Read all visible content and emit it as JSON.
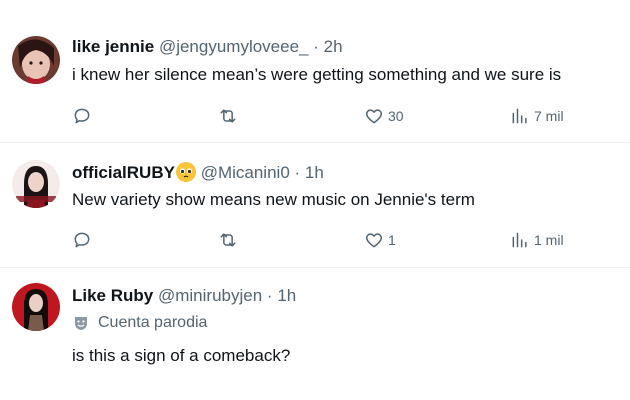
{
  "tweets": [
    {
      "name": "like jennie",
      "handle": "@jengyumyloveee_",
      "dot": "·",
      "time": "2h",
      "text": "i knew her silence mean’s were getting something and we sure is",
      "replies": "",
      "retweets": "",
      "likes": "30",
      "views": "7 mil"
    },
    {
      "name": "officialRUBY",
      "emoji": "pleading-face-emoji",
      "handle": "@Micanini0",
      "dot": "·",
      "time": "1h",
      "text": "New variety show means new music on Jennie's term",
      "replies": "",
      "retweets": "",
      "likes": "1",
      "views": "1 mil"
    },
    {
      "name": "Like Ruby",
      "handle": "@minirubyjen",
      "dot": "·",
      "time": "1h",
      "parody_label": "Cuenta parodia",
      "text": "is this a sign of a comeback?"
    }
  ],
  "colors": {
    "text": "#0f1419",
    "muted": "#536471",
    "divider": "#eff3f4"
  }
}
